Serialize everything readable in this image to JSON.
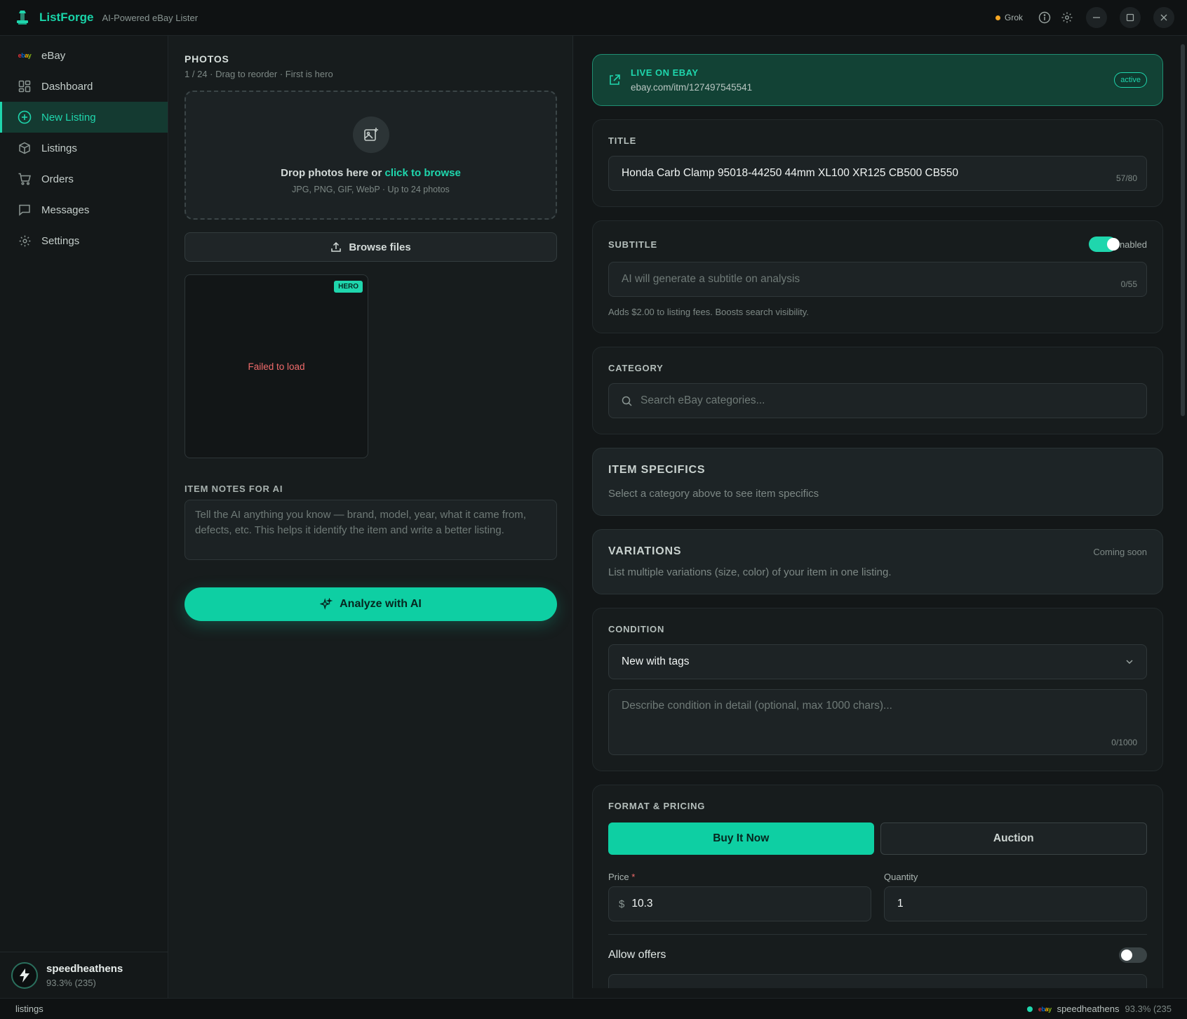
{
  "app": {
    "name": "ListForge",
    "tagline": "AI-Powered eBay Lister",
    "provider": "Grok"
  },
  "sidebar": {
    "items": [
      {
        "label": "eBay",
        "icon": "ebay-logo-icon"
      },
      {
        "label": "Dashboard",
        "icon": "dashboard-icon"
      },
      {
        "label": "New Listing",
        "icon": "plus-circle-icon",
        "active": true
      },
      {
        "label": "Listings",
        "icon": "package-icon"
      },
      {
        "label": "Orders",
        "icon": "cart-icon"
      },
      {
        "label": "Messages",
        "icon": "message-icon"
      },
      {
        "label": "Settings",
        "icon": "gear-icon"
      }
    ],
    "user": {
      "name": "speedheathens",
      "rating": "93.3% (235)"
    }
  },
  "photos": {
    "title": "PHOTOS",
    "subtitle": "1 / 24 · Drag to reorder · First is hero",
    "drop_text": "Drop photos here or",
    "drop_link": "click to browse",
    "drop_hint": "JPG, PNG, GIF, WebP · Up to 24 photos",
    "browse_label": "Browse files",
    "hero_badge": "HERO",
    "failed_text": "Failed to load"
  },
  "notes": {
    "label": "ITEM NOTES FOR AI",
    "placeholder": "Tell the AI anything you know — brand, model, year, what it came from, defects, etc. This helps it identify the item and write a better listing."
  },
  "analyze_label": "Analyze with AI",
  "live": {
    "title": "LIVE ON EBAY",
    "url": "ebay.com/itm/127497545541",
    "status": "active"
  },
  "title_field": {
    "label": "TITLE",
    "value": "Honda Carb Clamp 95018-44250 44mm XL100 XR125 CB500 CB550",
    "counter": "57/80"
  },
  "subtitle_field": {
    "label": "SUBTITLE",
    "toggle_label": "nabled",
    "placeholder": "AI will generate a subtitle on analysis",
    "counter": "0/55",
    "hint": "Adds $2.00 to listing fees. Boosts search visibility."
  },
  "category": {
    "label": "CATEGORY",
    "placeholder": "Search eBay categories..."
  },
  "item_specifics": {
    "title": "ITEM SPECIFICS",
    "text": "Select a category above to see item specifics"
  },
  "variations": {
    "title": "VARIATIONS",
    "badge": "Coming soon",
    "text": "List multiple variations (size, color) of your item in one listing."
  },
  "condition": {
    "label": "CONDITION",
    "selected": "New with tags",
    "detail_placeholder": "Describe condition in detail (optional, max 1000 chars)...",
    "counter": "0/1000"
  },
  "pricing": {
    "label": "FORMAT & PRICING",
    "buy_now": "Buy It Now",
    "auction": "Auction",
    "price_label": "Price",
    "required_mark": "*",
    "currency": "$",
    "price": "10.3",
    "quantity_label": "Quantity",
    "quantity": "1",
    "offers_label": "Allow offers"
  },
  "statusbar": {
    "left": "listings",
    "user": "speedheathens",
    "rating": "93.3% (235"
  },
  "colors": {
    "accent": "#1fd6ad",
    "background": "#14181a",
    "danger": "#f06b6b",
    "warning": "#f5a623"
  }
}
